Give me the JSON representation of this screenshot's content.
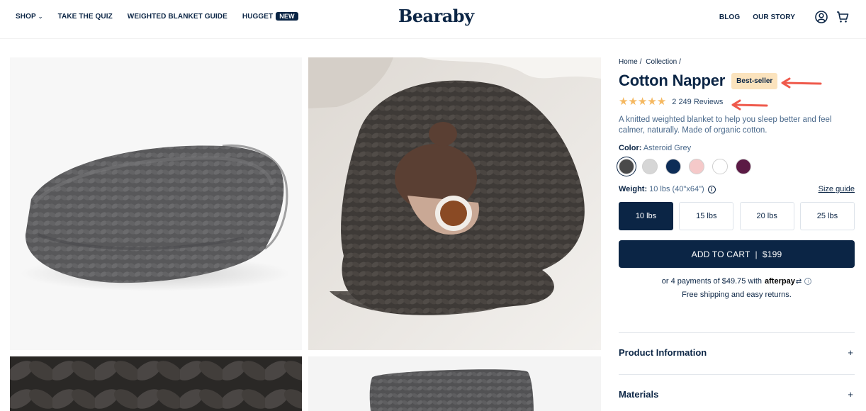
{
  "header": {
    "nav_left": [
      {
        "label": "SHOP",
        "has_chevron": true
      },
      {
        "label": "TAKE THE QUIZ"
      },
      {
        "label": "WEIGHTED BLANKET GUIDE"
      },
      {
        "label": "HUGGET",
        "badge": "NEW"
      }
    ],
    "logo": "Bearaby",
    "nav_right": [
      {
        "label": "BLOG"
      },
      {
        "label": "OUR STORY"
      }
    ],
    "icons": [
      "account-icon",
      "cart-icon"
    ]
  },
  "gallery": {
    "images": [
      "folded-knit-blanket",
      "woman-wrapped-in-blanket-with-tea",
      "knit-close-up",
      "rolled-knit-blanket"
    ]
  },
  "product": {
    "breadcrumb": [
      "Home",
      "/",
      "Collection",
      "/"
    ],
    "title": "Cotton Napper",
    "badge": "Best-seller",
    "rating": 5,
    "reviews": "2 249 Reviews",
    "description": "A knitted weighted blanket to help you sleep better and feel calmer, naturally. Made of organic cotton.",
    "color_label": "Color:",
    "color_value": "Asteroid Grey",
    "swatches": [
      {
        "name": "Asteroid Grey",
        "hex": "#4a4a4a",
        "selected": true
      },
      {
        "name": "Light Grey",
        "hex": "#d6d6d6"
      },
      {
        "name": "Navy",
        "hex": "#0d2d57"
      },
      {
        "name": "Blush",
        "hex": "#f5c9c9"
      },
      {
        "name": "White",
        "hex": "#ffffff"
      },
      {
        "name": "Plum",
        "hex": "#5b1a45"
      }
    ],
    "weight_label": "Weight:",
    "weight_value": "10 lbs (40\"x64\")",
    "size_guide": "Size guide",
    "weights": [
      {
        "label": "10 lbs",
        "selected": true
      },
      {
        "label": "15 lbs"
      },
      {
        "label": "20 lbs"
      },
      {
        "label": "25 lbs"
      }
    ],
    "add_to_cart": "ADD TO CART",
    "price": "$199",
    "afterpay_text": "or 4 payments of $49.75 with",
    "afterpay_brand": "afterpay",
    "shipping": "Free shipping and easy returns.",
    "accordions": [
      {
        "title": "Product Information",
        "icon": "+"
      },
      {
        "title": "Materials",
        "icon": "+"
      }
    ]
  },
  "colors": {
    "navy": "#0b2545",
    "star": "#f5b860",
    "badge_bg": "#fbe3bd",
    "annotation": "#ef5a4c"
  }
}
